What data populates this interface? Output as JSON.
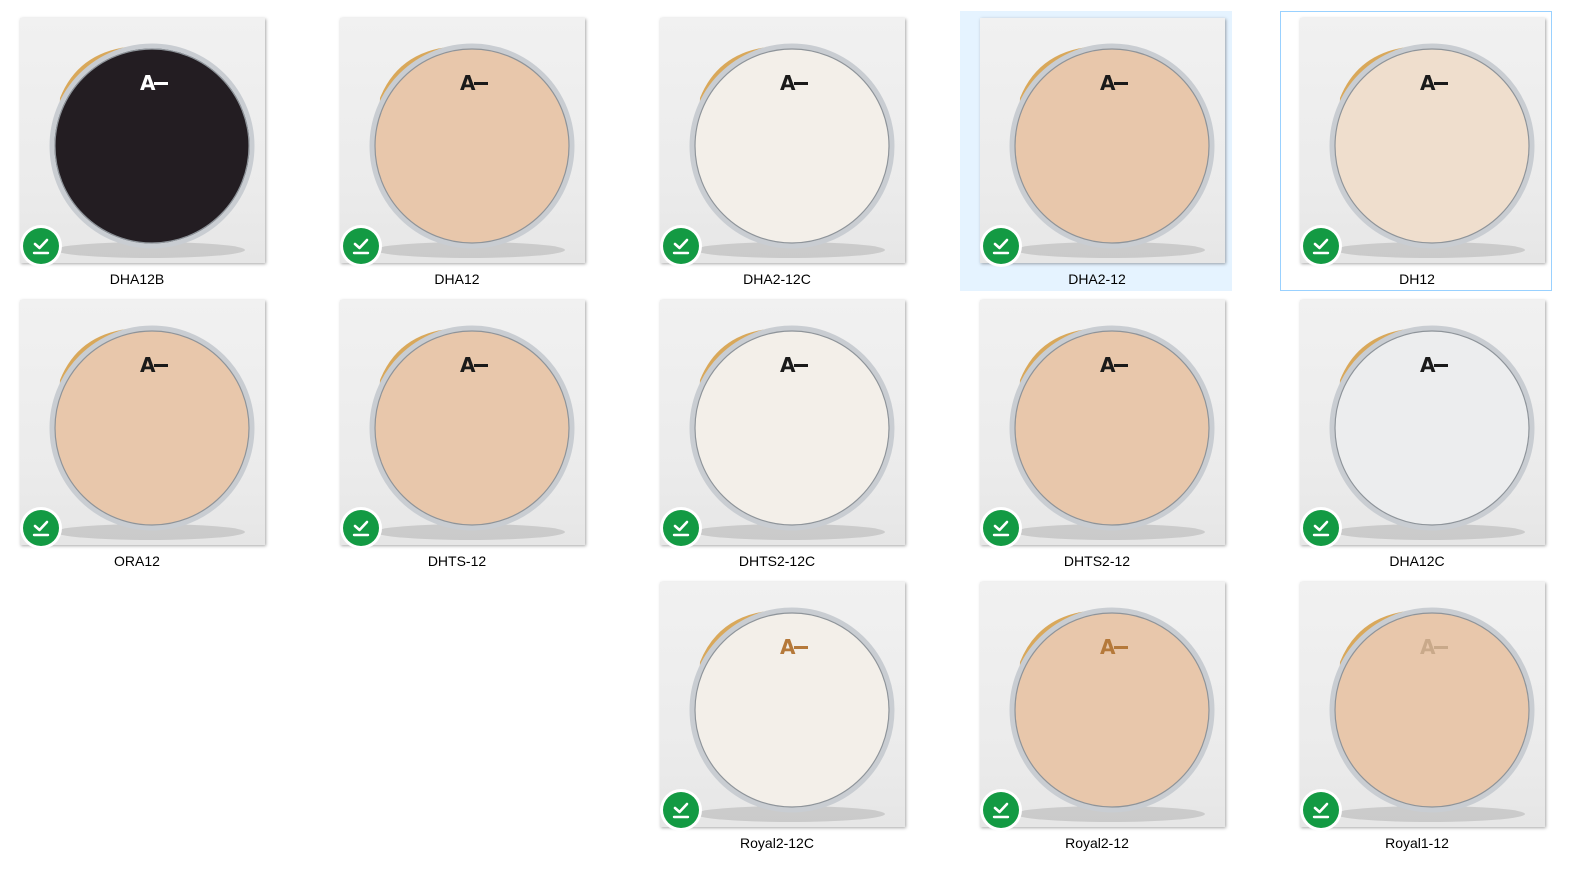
{
  "view": "large-icons",
  "sync_status_icon": "synced-checkmark-icon",
  "accent_colors": {
    "sync_green": "#139a43",
    "hover_fill": "#e5f3ff",
    "focus_border": "#99d1ff"
  },
  "files": [
    {
      "name": "DHA12B",
      "head": "black",
      "logo_color": "#ffffff"
    },
    {
      "name": "DHA12",
      "head": "clear",
      "logo_color": "#1a1a1a"
    },
    {
      "name": "DHA2-12C",
      "head": "coated",
      "logo_color": "#1a1a1a"
    },
    {
      "name": "DHA2-12",
      "head": "clear",
      "logo_color": "#1a1a1a",
      "state": "hover"
    },
    {
      "name": "DH12",
      "head": "frosted",
      "logo_color": "#1a1a1a",
      "state": "focus"
    },
    {
      "name": "ORA12",
      "head": "clear",
      "logo_color": "#1a1a1a"
    },
    {
      "name": "DHTS-12",
      "head": "clear",
      "logo_color": "#1a1a1a"
    },
    {
      "name": "DHTS2-12C",
      "head": "coated",
      "logo_color": "#1a1a1a"
    },
    {
      "name": "DHTS2-12",
      "head": "clear",
      "logo_color": "#1a1a1a"
    },
    {
      "name": "DHA12C",
      "head": "white",
      "logo_color": "#1a1a1a"
    },
    {
      "name": "Royal2-12C",
      "head": "coated",
      "logo_color": "#b5793a"
    },
    {
      "name": "Royal2-12",
      "head": "clear",
      "logo_color": "#b5793a"
    },
    {
      "name": "Royal1-12",
      "head": "clear",
      "logo_color": "#c9a98a"
    }
  ]
}
